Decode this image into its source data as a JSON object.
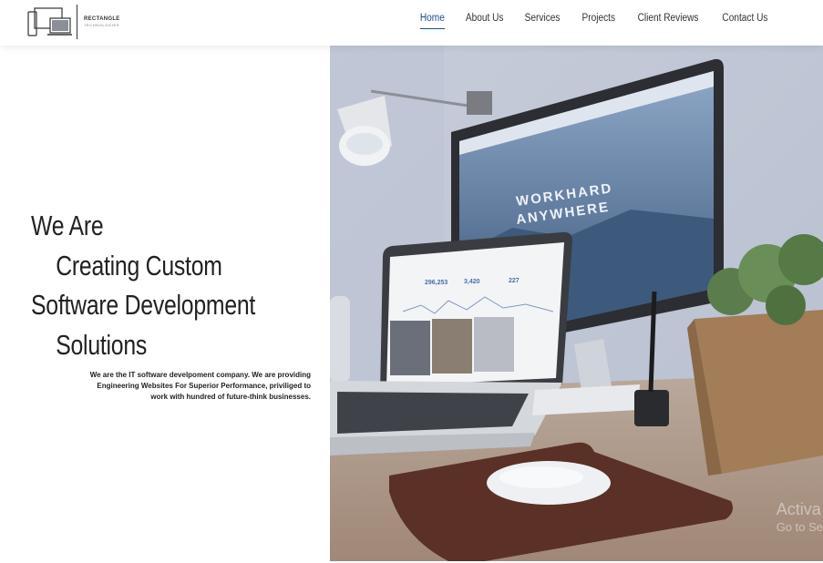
{
  "brand": {
    "name": "RECTANGLE",
    "subtitle": "TECHNOLOGIES"
  },
  "nav": {
    "items": [
      {
        "label": "Home",
        "active": true
      },
      {
        "label": "About Us",
        "active": false
      },
      {
        "label": "Services",
        "active": false
      },
      {
        "label": "Projects",
        "active": false
      },
      {
        "label": "Client Reviews",
        "active": false
      },
      {
        "label": "Contact Us",
        "active": false
      }
    ]
  },
  "hero": {
    "line1": "We Are",
    "line2": "Creating Custom",
    "line3": "Software Development",
    "line4": "Solutions",
    "description": "We are the IT software develpoment company. We are providing Engineering Websites For Superior Performance, priviliged to work with hundred of future-think businesses."
  },
  "photo": {
    "monitor_text_1": "WORKHARD",
    "monitor_text_2": "ANYWHERE",
    "laptop_stat_1": "296,253",
    "laptop_stat_2": "3,420",
    "laptop_stat_3": "227"
  },
  "watermark": {
    "line1": "Activa",
    "line2": "Go to Se"
  },
  "colors": {
    "accent": "#1a4f8f",
    "text": "#222222",
    "photo_tint": "#c9cfdc"
  }
}
